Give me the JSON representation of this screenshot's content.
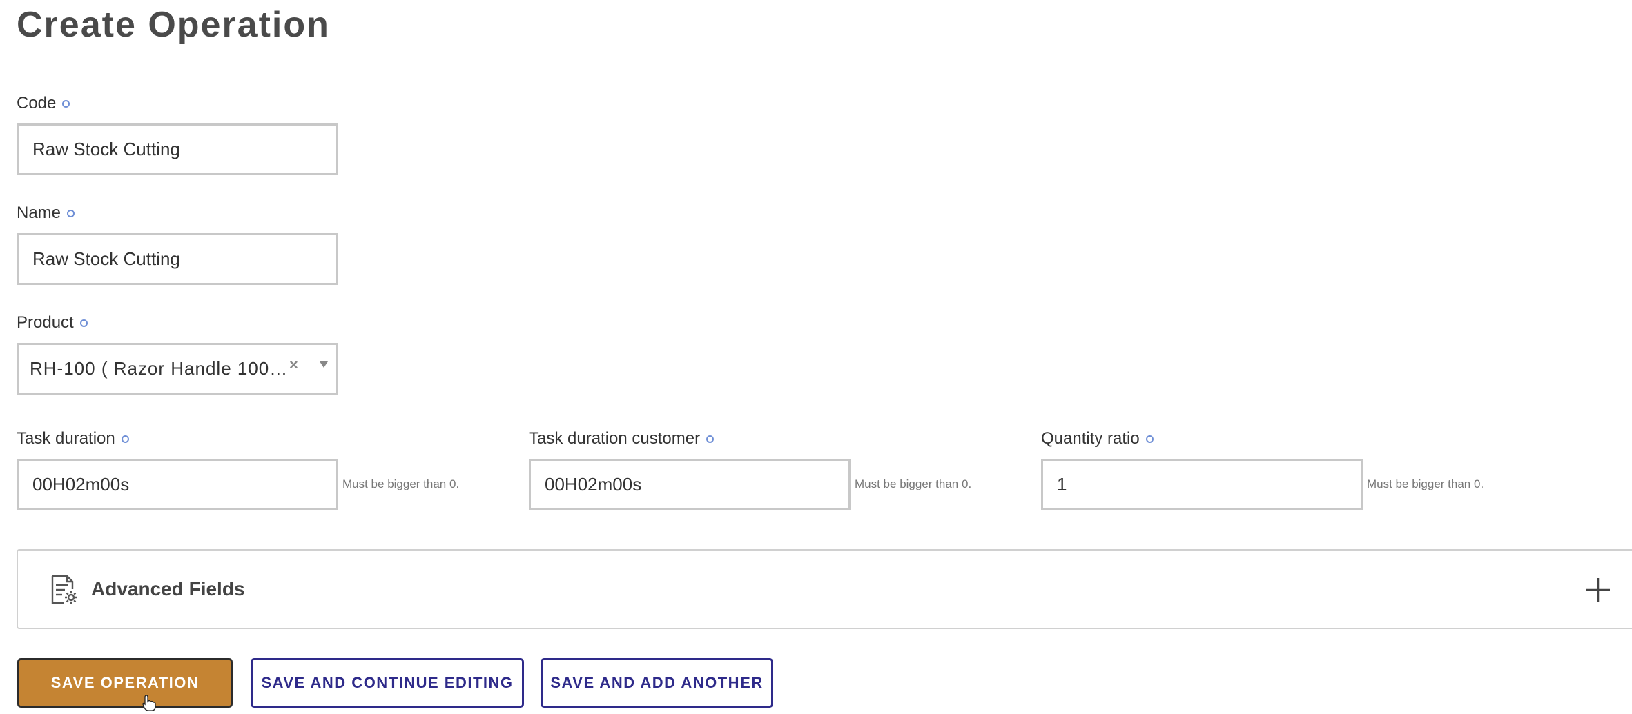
{
  "page": {
    "title": "Create Operation"
  },
  "fields": {
    "code": {
      "label": "Code",
      "value": "Raw Stock Cutting"
    },
    "name": {
      "label": "Name",
      "value": "Raw Stock Cutting"
    },
    "product": {
      "label": "Product",
      "value": "RH-100 ( Razor Handle 100m…",
      "clear_glyph": "×"
    },
    "task_duration": {
      "label": "Task duration",
      "value": "00H02m00s",
      "help": "Must be bigger than 0."
    },
    "task_duration_customer": {
      "label": "Task duration customer",
      "value": "00H02m00s",
      "help": "Must be bigger than 0."
    },
    "quantity_ratio": {
      "label": "Quantity ratio",
      "value": "1",
      "help": "Must be bigger than 0."
    }
  },
  "advanced": {
    "label": "Advanced Fields",
    "icon": "document-settings-icon",
    "toggle_icon": "plus-icon"
  },
  "buttons": {
    "save": "SAVE OPERATION",
    "save_continue": "SAVE AND CONTINUE EDITING",
    "save_add_another": "SAVE AND ADD ANOTHER"
  },
  "colors": {
    "primary_button": "#c58433",
    "secondary_button": "#2e2a8a",
    "required_dot": "#6f8fd6",
    "input_border": "#c8c8c8"
  }
}
